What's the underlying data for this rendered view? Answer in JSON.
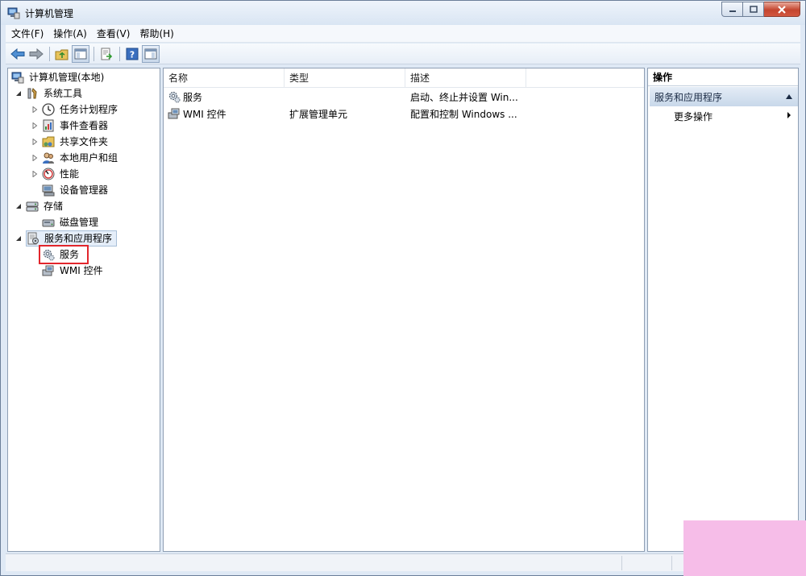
{
  "window": {
    "title": "计算机管理"
  },
  "menu": [
    {
      "label": "文件(F)"
    },
    {
      "label": "操作(A)"
    },
    {
      "label": "查看(V)"
    },
    {
      "label": "帮助(H)"
    }
  ],
  "tree": {
    "root": "计算机管理(本地)",
    "system_tools": "系统工具",
    "task_scheduler": "任务计划程序",
    "event_viewer": "事件查看器",
    "shared_folders": "共享文件夹",
    "local_users": "本地用户和组",
    "performance": "性能",
    "device_manager": "设备管理器",
    "storage": "存储",
    "disk_management": "磁盘管理",
    "services_apps": "服务和应用程序",
    "services": "服务",
    "wmi": "WMI 控件"
  },
  "list": {
    "columns": [
      "名称",
      "类型",
      "描述"
    ],
    "rows": [
      {
        "name": "服务",
        "type": "",
        "desc": "启动、终止并设置 Win..."
      },
      {
        "name": "WMI 控件",
        "type": "扩展管理单元",
        "desc": "配置和控制 Windows ..."
      }
    ]
  },
  "actions": {
    "header": "操作",
    "section": "服务和应用程序",
    "more": "更多操作"
  },
  "colors": {
    "highlight": "#e2262c",
    "corner": "#f6bde8"
  }
}
